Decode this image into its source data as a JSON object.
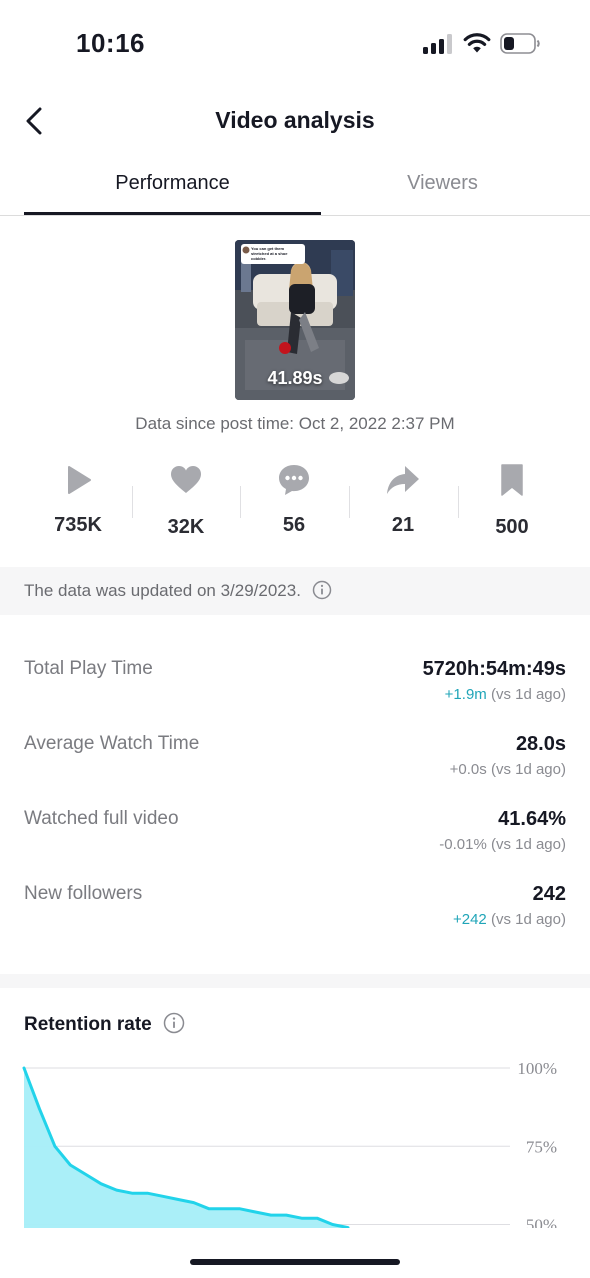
{
  "status_bar": {
    "time": "10:16"
  },
  "nav": {
    "title": "Video analysis"
  },
  "tabs": [
    {
      "label": "Performance",
      "active": true
    },
    {
      "label": "Viewers",
      "active": false
    }
  ],
  "video": {
    "duration": "41.89s",
    "caption": "You can get them stretched at a shoe cobbler."
  },
  "since_text": "Data since post time: Oct 2, 2022 2:37 PM",
  "stats": [
    {
      "icon": "play-icon",
      "value": "735K"
    },
    {
      "icon": "heart-icon",
      "value": "32K"
    },
    {
      "icon": "comment-icon",
      "value": "56"
    },
    {
      "icon": "share-icon",
      "value": "21"
    },
    {
      "icon": "bookmark-icon",
      "value": "500"
    }
  ],
  "update_banner": "The data was updated on 3/29/2023.",
  "metrics": [
    {
      "label": "Total Play Time",
      "value": "5720h:54m:49s",
      "delta": "+1.9m",
      "delta_note": " (vs 1d ago)",
      "positive": true
    },
    {
      "label": "Average Watch Time",
      "value": "28.0s",
      "delta": "+0.0s",
      "delta_note": " (vs 1d ago)",
      "positive": false
    },
    {
      "label": "Watched full video",
      "value": "41.64%",
      "delta": "-0.01%",
      "delta_note": " (vs 1d ago)",
      "positive": false
    },
    {
      "label": "New followers",
      "value": "242",
      "delta": "+242",
      "delta_note": " (vs 1d ago)",
      "positive": true
    }
  ],
  "retention": {
    "title": "Retention rate",
    "color_line": "#22d3ea",
    "color_fill": "#a5eef8"
  },
  "chart_data": {
    "type": "area",
    "title": "Retention rate",
    "y_ticks": [
      "100%",
      "75%",
      "50%"
    ],
    "ylim_visible": [
      50,
      100
    ],
    "x": [
      0,
      2,
      4,
      6,
      8,
      10,
      12,
      14,
      16,
      18,
      20,
      22,
      24,
      26,
      28,
      30,
      32,
      34,
      36,
      38,
      40,
      42
    ],
    "values": [
      100,
      87,
      75,
      69,
      66,
      63,
      61,
      60,
      60,
      59,
      58,
      57,
      55,
      55,
      55,
      54,
      53,
      53,
      52,
      52,
      50,
      49
    ]
  }
}
